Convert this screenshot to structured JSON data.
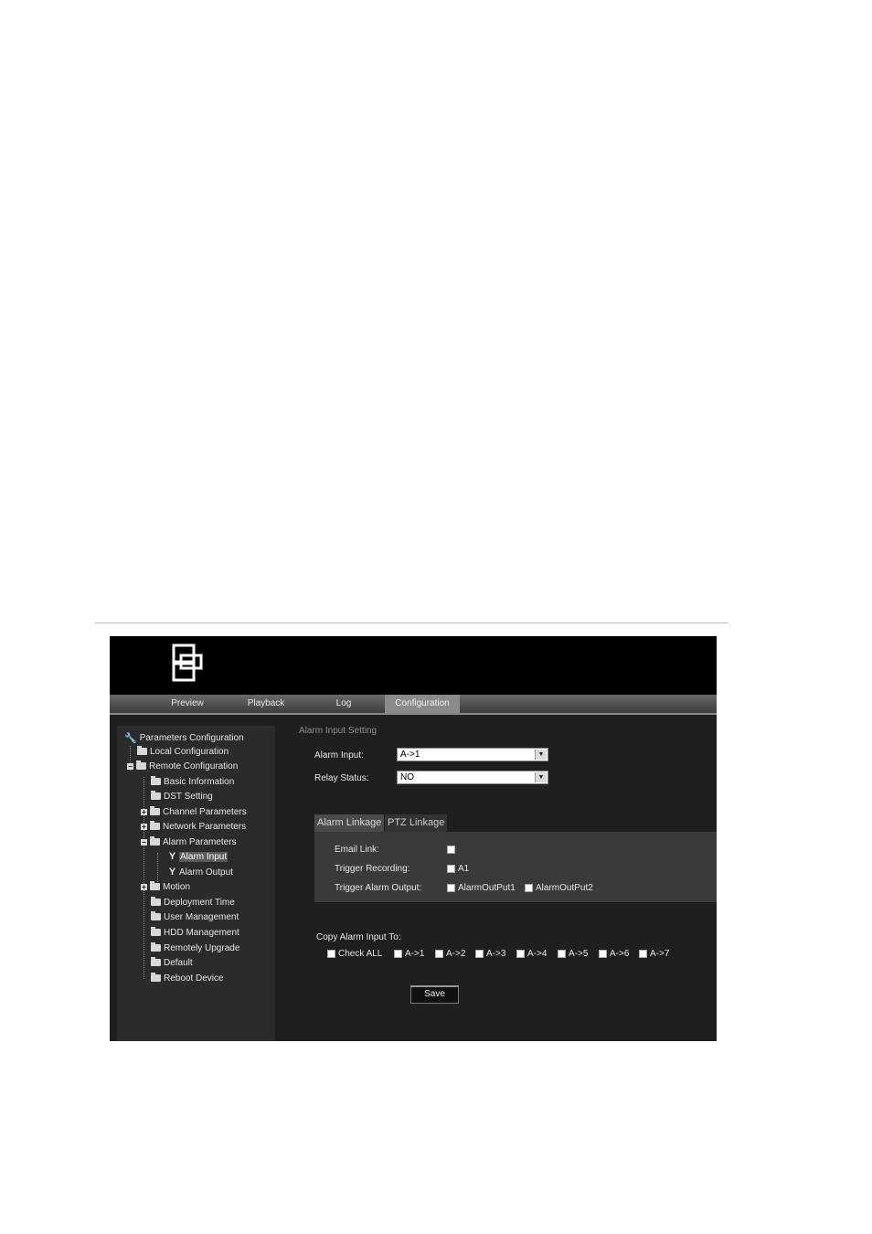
{
  "nav": {
    "tabs": [
      {
        "label": "Preview"
      },
      {
        "label": "Playback"
      },
      {
        "label": "Log"
      },
      {
        "label": "Configuration"
      }
    ],
    "active": "Configuration"
  },
  "sidebar": {
    "root": "Parameters Configuration",
    "items": [
      {
        "label": "Local Configuration"
      },
      {
        "label": "Remote Configuration"
      },
      {
        "label": "Basic Information"
      },
      {
        "label": "DST Setting"
      },
      {
        "label": "Channel Parameters"
      },
      {
        "label": "Network Parameters"
      },
      {
        "label": "Alarm Parameters"
      },
      {
        "label": "Alarm Input"
      },
      {
        "label": "Alarm Output"
      },
      {
        "label": "Motion"
      },
      {
        "label": "Deployment Time"
      },
      {
        "label": "User Management"
      },
      {
        "label": "HDD Management"
      },
      {
        "label": "Remotely Upgrade"
      },
      {
        "label": "Default"
      },
      {
        "label": "Reboot Device"
      }
    ],
    "selected": "Alarm Input"
  },
  "content": {
    "title": "Alarm Input Setting",
    "alarm_input": {
      "label": "Alarm Input:",
      "value": "A->1"
    },
    "relay_status": {
      "label": "Relay Status:",
      "value": "NO"
    },
    "tabs": [
      {
        "label": "Alarm Linkage"
      },
      {
        "label": "PTZ Linkage"
      }
    ],
    "linkage": {
      "email": {
        "label": "Email Link:"
      },
      "trigger_recording": {
        "label": "Trigger Recording:",
        "options": [
          "A1"
        ]
      },
      "trigger_alarm_output": {
        "label": "Trigger Alarm Output:",
        "options": [
          "AlarmOutPut1",
          "AlarmOutPut2"
        ]
      }
    },
    "copy": {
      "label": "Copy Alarm Input To:",
      "options": [
        "Check ALL",
        "A->1",
        "A->2",
        "A->3",
        "A->4",
        "A->5",
        "A->6",
        "A->7"
      ]
    },
    "save_label": "Save"
  }
}
